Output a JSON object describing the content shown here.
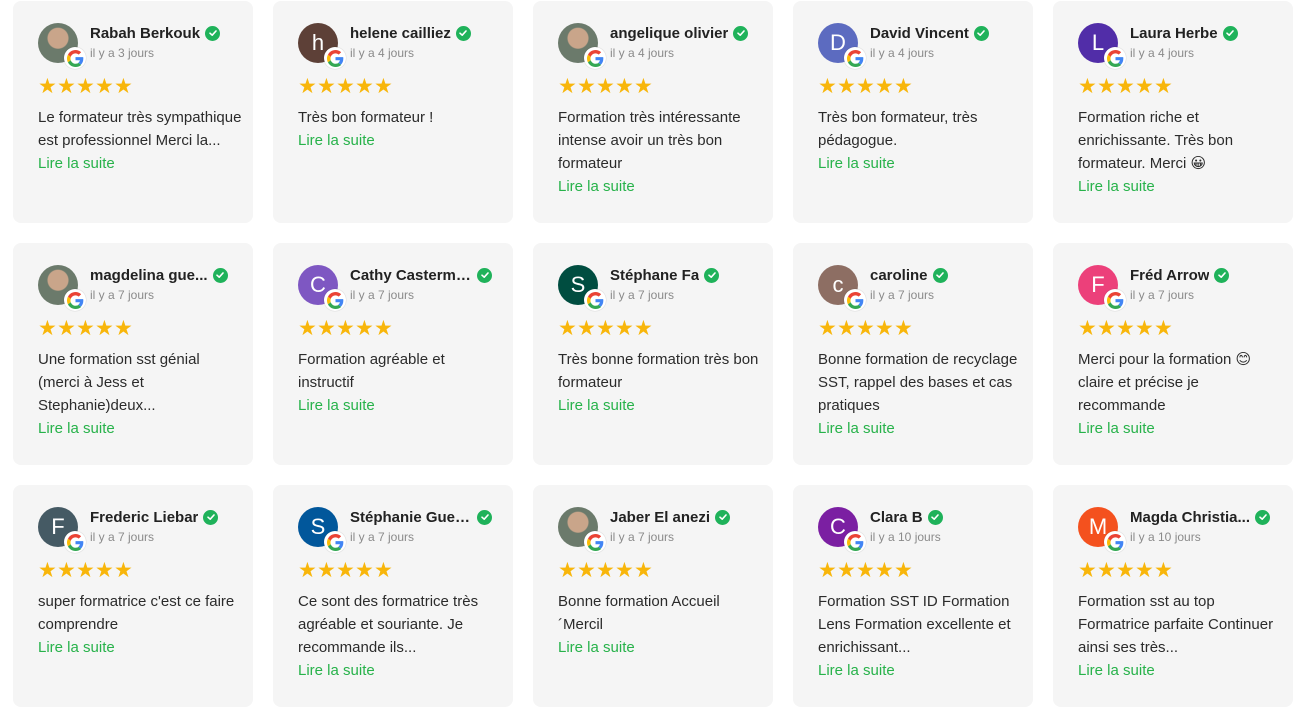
{
  "colors": {
    "star": "#f8b60b",
    "verified": "#1fb25a",
    "read_more": "#27b24a",
    "card_bg": "#f5f5f5"
  },
  "read_more_label": "Lire la suite",
  "reviews": [
    {
      "name": "Rabah Berkouk",
      "date": "il y a 3 jours",
      "initial": "",
      "avatar_color": "",
      "photo": true,
      "text": "Le formateur très sympathique est professionnel Merci la..."
    },
    {
      "name": "helene cailliez",
      "date": "il y a 4 jours",
      "initial": "h",
      "avatar_color": "#5d4037",
      "photo": false,
      "text": "Très bon formateur !"
    },
    {
      "name": "angelique olivier",
      "date": "il y a 4 jours",
      "initial": "",
      "avatar_color": "",
      "photo": true,
      "text": "Formation très intéressante intense avoir un très bon formateur"
    },
    {
      "name": "David Vincent",
      "date": "il y a 4 jours",
      "initial": "D",
      "avatar_color": "#5c6bc0",
      "photo": false,
      "text": "Très bon formateur, très pédagogue."
    },
    {
      "name": "Laura Herbe",
      "date": "il y a 4 jours",
      "initial": "L",
      "avatar_color": "#512da8",
      "photo": false,
      "text": "Formation riche et enrichissante. Très bon formateur. Merci 😀"
    },
    {
      "name": "magdelina gue...",
      "date": "il y a 7 jours",
      "initial": "",
      "avatar_color": "",
      "photo": true,
      "text": "Une formation sst génial (merci à Jess et Stephanie)deux..."
    },
    {
      "name": "Cathy Casterman",
      "date": "il y a 7 jours",
      "initial": "C",
      "avatar_color": "#7e57c2",
      "photo": false,
      "text": "Formation agréable et instructif"
    },
    {
      "name": "Stéphane Fa",
      "date": "il y a 7 jours",
      "initial": "S",
      "avatar_color": "#004d40",
      "photo": false,
      "text": "Très bonne formation très bon formateur"
    },
    {
      "name": "caroline",
      "date": "il y a 7 jours",
      "initial": "c",
      "avatar_color": "#8d6e63",
      "photo": false,
      "text": "Bonne formation de recyclage SST, rappel des bases et cas pratiques"
    },
    {
      "name": "Fréd Arrow",
      "date": "il y a 7 jours",
      "initial": "F",
      "avatar_color": "#ec407a",
      "photo": false,
      "text": "Merci pour la formation 😊 claire et précise je recommande"
    },
    {
      "name": "Frederic Liebar",
      "date": "il y a 7 jours",
      "initial": "F",
      "avatar_color": "#455a64",
      "photo": false,
      "text": "super formatrice c'est ce faire comprendre"
    },
    {
      "name": "Stéphanie Guer...",
      "date": "il y a 7 jours",
      "initial": "S",
      "avatar_color": "#01579b",
      "photo": false,
      "text": "Ce sont des formatrice très agréable et souriante. Je recommande ils..."
    },
    {
      "name": "Jaber El anezi",
      "date": "il y a 7 jours",
      "initial": "",
      "avatar_color": "",
      "photo": true,
      "text": "Bonne formation Accueil ´Mercil"
    },
    {
      "name": "Clara B",
      "date": "il y a 10 jours",
      "initial": "C",
      "avatar_color": "#7b1fa2",
      "photo": false,
      "text": "Formation SST ID Formation Lens Formation excellente et enrichissant..."
    },
    {
      "name": "Magda Christia...",
      "date": "il y a 10 jours",
      "initial": "M",
      "avatar_color": "#f4511e",
      "photo": false,
      "text": "Formation sst au top Formatrice parfaite Continuer ainsi ses très..."
    }
  ]
}
